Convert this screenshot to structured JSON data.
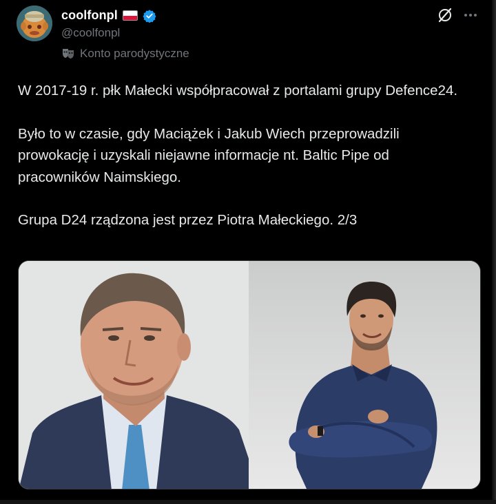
{
  "author": {
    "display_name": "coolfonpl",
    "handle": "@coolfonpl",
    "parody_label": "Konto parodystyczne",
    "flag": "poland-flag-icon",
    "verified_color": "#1d9bf0"
  },
  "tweet": {
    "paragraphs": [
      "W 2017-19 r. płk Małecki współpracował z portalami grupy Defence24.",
      "Było to w czasie, gdy Maciążek i Jakub Wiech przeprowadzili prowokację i uzyskali niejawne informacje nt. Baltic Pipe od pracowników Naimskiego.",
      "Grupa D24 rządzona jest przez Piotra Małeckiego. 2/3"
    ]
  },
  "media": {
    "left_photo": "portrait-man-suit",
    "right_photo": "portrait-man-denim-shirt"
  },
  "actions": {
    "grok_icon": "grok-icon",
    "more_icon": "more-icon"
  },
  "colors": {
    "background": "#000000",
    "text": "#e7e9ea",
    "secondary_text": "#71767b",
    "verified": "#1d9bf0"
  }
}
